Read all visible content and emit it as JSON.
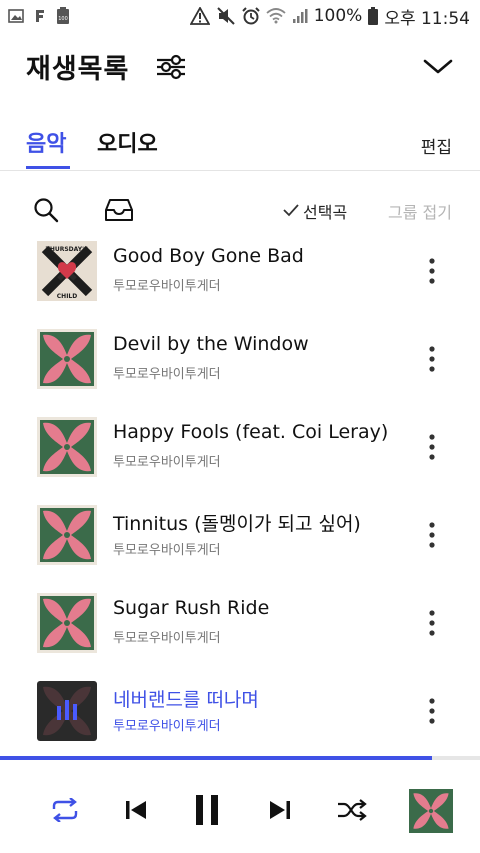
{
  "status_bar": {
    "battery_text": "100%",
    "time": "오후 11:54",
    "left_icons": [
      "gallery-icon",
      "app-f-icon",
      "battery-saver-icon"
    ],
    "right_icons": [
      "alert-icon",
      "mute-icon",
      "alarm-icon",
      "wifi-icon",
      "signal-icon",
      "battery-icon"
    ]
  },
  "header": {
    "title": "재생목록",
    "filter_icon": "sliders-icon",
    "collapse_icon": "chevron-down-icon"
  },
  "tabs": [
    {
      "label": "음악",
      "active": true
    },
    {
      "label": "오디오",
      "active": false
    }
  ],
  "edit_label": "편집",
  "toolbar": {
    "select_label": "선택곡",
    "fold_label": "그룹 접기"
  },
  "songs": [
    {
      "title": "Good Boy Gone Bad",
      "artist": "투모로우바이투게더",
      "art": "thursdays-child",
      "playing": false
    },
    {
      "title": "Devil by the Window",
      "artist": "투모로우바이투게더",
      "art": "temptation",
      "playing": false
    },
    {
      "title": "Happy Fools (feat. Coi Leray)",
      "artist": "투모로우바이투게더",
      "art": "temptation",
      "playing": false
    },
    {
      "title": "Tinnitus (돌멩이가 되고 싶어)",
      "artist": "투모로우바이투게더",
      "art": "temptation",
      "playing": false
    },
    {
      "title": "Sugar Rush Ride",
      "artist": "투모로우바이투게더",
      "art": "temptation",
      "playing": false
    },
    {
      "title": "네버랜드를 떠나며",
      "artist": "투모로우바이투게더",
      "art": "temptation",
      "playing": true
    }
  ],
  "player": {
    "progress": 0.9,
    "controls": [
      "repeat-icon",
      "previous-icon",
      "pause-icon",
      "next-icon",
      "shuffle-icon"
    ]
  },
  "colors": {
    "accent": "#3f51e6",
    "album_green": "#3b6b4a",
    "album_pink": "#e47c8e"
  }
}
